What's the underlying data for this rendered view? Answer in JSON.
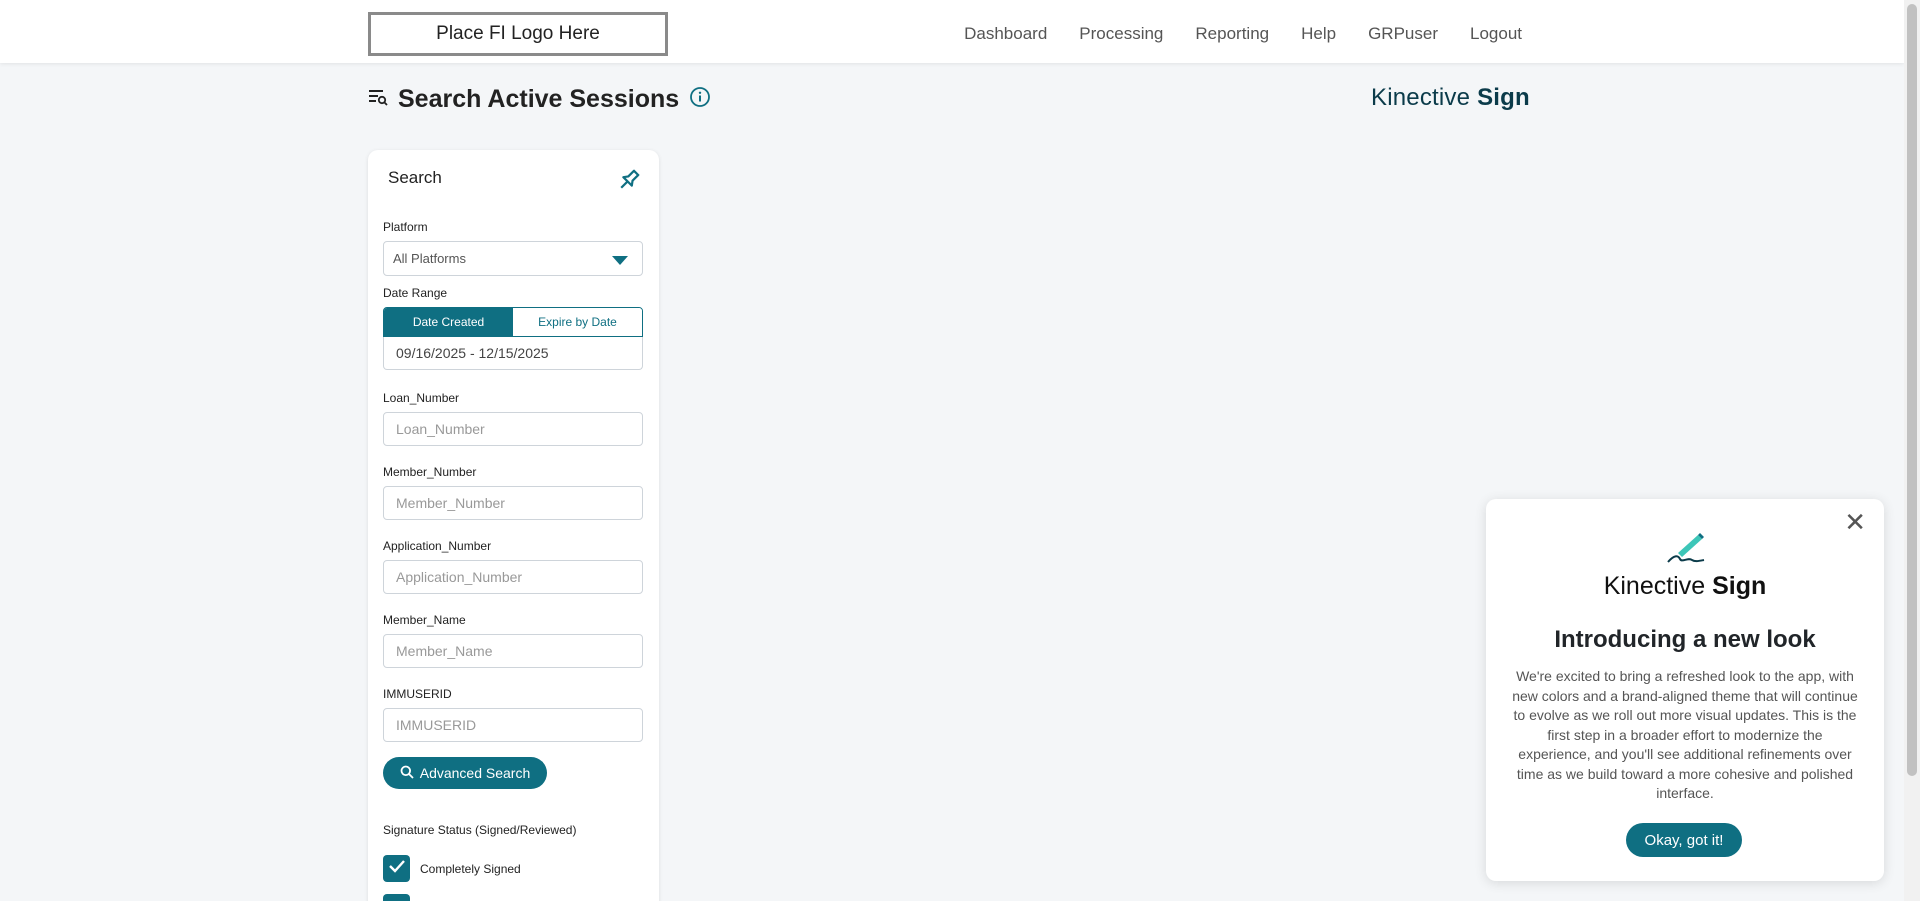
{
  "header": {
    "logo_placeholder": "Place FI Logo Here",
    "nav": [
      "Dashboard",
      "Processing",
      "Reporting",
      "Help",
      "GRPuser",
      "Logout"
    ]
  },
  "page": {
    "title": "Search Active Sessions",
    "brand_light": "Kinective",
    "brand_bold": "Sign"
  },
  "search": {
    "title": "Search",
    "platform_label": "Platform",
    "platform_value": "All Platforms",
    "date_range_label": "Date Range",
    "date_tabs": [
      "Date Created",
      "Expire by Date"
    ],
    "date_value": "09/16/2025 - 12/15/2025",
    "fields": [
      {
        "label": "Loan_Number",
        "placeholder": "Loan_Number"
      },
      {
        "label": "Member_Number",
        "placeholder": "Member_Number"
      },
      {
        "label": "Application_Number",
        "placeholder": "Application_Number"
      },
      {
        "label": "Member_Name",
        "placeholder": "Member_Name"
      },
      {
        "label": "IMMUSERID",
        "placeholder": "IMMUSERID"
      }
    ],
    "advanced_button": "Advanced Search",
    "signature_status_label": "Signature Status (Signed/Reviewed)",
    "checkbox_1_label": "Completely Signed"
  },
  "popup": {
    "brand_light": "Kinective",
    "brand_bold": "Sign",
    "heading": "Introducing a new look",
    "body": "We're excited to bring a refreshed look to the app, with new colors and a brand-aligned theme that will continue to evolve as we roll out more visual updates. This is the first step in a broader effort to modernize the experience, and you'll see additional refinements over time as we build toward a more cohesive and polished interface.",
    "button": "Okay, got it!"
  },
  "colors": {
    "accent": "#0f6f82",
    "brand_dark": "#0b3b4a",
    "background": "#f4f6f8"
  }
}
